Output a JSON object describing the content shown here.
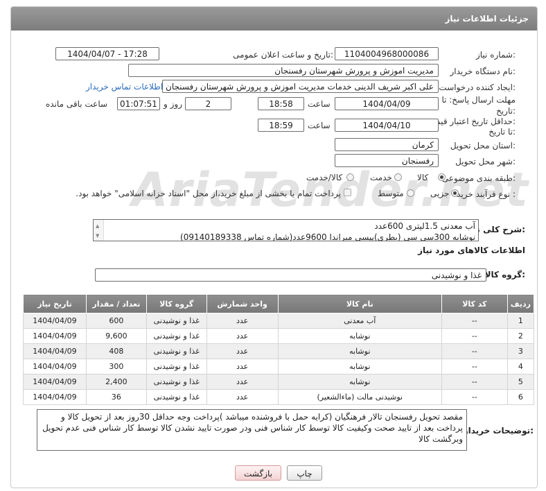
{
  "header": {
    "title": "جزئیات اطلاعات نیاز"
  },
  "fields": {
    "need_number_label": "شماره نیاز:",
    "need_number": "1104004968000086",
    "announce_label": "تاریخ و ساعت اعلان عمومی:",
    "announce_value": "1404/04/07 - 17:28",
    "buyer_org_label": "نام دستگاه خریدار:",
    "buyer_org": "مدیریت اموزش و پرورش شهرستان رفسنجان",
    "creator_label": "ایجاد کننده درخواست:",
    "creator": "علی اکبر شریف الدینی خدمات مدیریت اموزش و پرورش شهرستان رفسنجان",
    "contact_link": "اطلاعات تماس خریدار",
    "deadline_label_1": "مهلت ارسال پاسخ: تا",
    "deadline_label_2": "تاریخ:",
    "deadline_date": "1404/04/09",
    "time_label": "ساعت",
    "deadline_time": "18:58",
    "days_value": "2",
    "days_label": "روز و",
    "remaining_time": "01:07:51",
    "remaining_label": "ساعت باقی مانده",
    "validity_label_1": "حداقل تاریخ اعتبار قیمت:",
    "validity_label_2": "تا تاریخ:",
    "validity_date": "1404/04/10",
    "validity_time": "18:59",
    "province_label": "استان محل تحویل:",
    "province": "کرمان",
    "city_label": "شهر محل تحویل:",
    "city": "رفسنجان",
    "category_label": "طبقه بندی موضوعی:",
    "category_options": [
      "کالا",
      "خدمت",
      "کالا/خدمت"
    ],
    "category_selected": "کالا",
    "process_label": "نوع فرآیند خرید :",
    "process_options": [
      "جزیی",
      "متوسط"
    ],
    "process_selected": "جزیی",
    "payment_note": "پرداخت تمام یا بخشی از مبلغ خرید،از محل \"اسناد خزانه اسلامی\" خواهد بود."
  },
  "description": {
    "label": "شرح کلی نیاز:",
    "lines": [
      "آب معدنی 1.5لیتری 600عدد",
      "نوشابه 300سی سی (بطری)پپسی میراندا 9600عدد(شماره تماس 09140189338)"
    ]
  },
  "goods_section": {
    "title": "اطلاعات کالاهای مورد نیاز",
    "group_label": "گروه کالا:",
    "group_value": "غذا و نوشیدنی"
  },
  "table": {
    "headers": [
      "ردیف",
      "کد کالا",
      "نام کالا",
      "واحد شمارش",
      "گروه کالا",
      "تعداد / مقدار",
      "تاریخ نیاز"
    ],
    "rows": [
      [
        "1",
        "--",
        "آب معدنی",
        "عدد",
        "غذا و نوشیدنی",
        "600",
        "1404/04/09"
      ],
      [
        "2",
        "--",
        "نوشابه",
        "عدد",
        "غذا و نوشیدنی",
        "9,600",
        "1404/04/09"
      ],
      [
        "3",
        "--",
        "نوشابه",
        "عدد",
        "غذا و نوشیدنی",
        "408",
        "1404/04/09"
      ],
      [
        "4",
        "--",
        "نوشابه",
        "عدد",
        "غذا و نوشیدنی",
        "300",
        "1404/04/09"
      ],
      [
        "5",
        "--",
        "نوشابه",
        "عدد",
        "غذا و نوشیدنی",
        "2,400",
        "1404/04/09"
      ],
      [
        "6",
        "--",
        "نوشیدنی مالت (ماءالشعیر)",
        "عدد",
        "غذا و نوشیدنی",
        "36",
        "1404/04/09"
      ]
    ]
  },
  "buyer_notes": {
    "label": "توضیحات خریدار:",
    "text": "مقصد تحویل رفسنجان تالار فرهنگیان (کرایه حمل با فروشنده میباشد )پرداخت وجه حداقل 30روز بعد از تحویل کالا و پرداخت بعد از تایید صحت وکیفیت کالا توسط کار شناس فنی ودر صورت تایید نشدن کالا توسط کار شناس فنی عدم تحویل وبرگشت کالا"
  },
  "buttons": {
    "print": "چاپ",
    "back": "بازگشت"
  },
  "watermark": "AriaTender.net"
}
